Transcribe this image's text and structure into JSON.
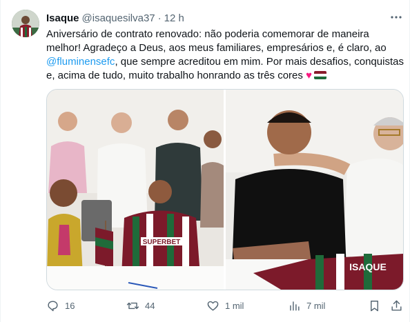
{
  "tweet": {
    "author_name": "Isaque",
    "author_handle": "@isaquesilva37",
    "separator": "·",
    "time": "12 h",
    "text_part1": "Aniversário de contrato renovado: não poderia comemorar de maneira melhor! Agradeço a Deus, aos meus familiares, empresários e, é claro, ao ",
    "mention": "@fluminensefc",
    "text_part2": ", que sempre acreditou em mim. Por mais desafios, conquistas e, acima de tudo, muito trabalho honrando as três cores ",
    "heart_emoji": "♥",
    "flag_colors": [
      "#8a1c2b",
      "#ffffff",
      "#1f6b3a"
    ]
  },
  "media": {
    "left_photo": {
      "shirt_sponsor_text": "SUPERBET"
    },
    "right_photo": {
      "shirt_name_text": "ISAQUE"
    }
  },
  "actions": {
    "replies": "16",
    "reposts": "44",
    "likes": "1 mil",
    "views": "7 mil"
  },
  "colors": {
    "text": "#0f1419",
    "secondary": "#536471",
    "link": "#1d9bf0",
    "border": "#cfd9de"
  }
}
